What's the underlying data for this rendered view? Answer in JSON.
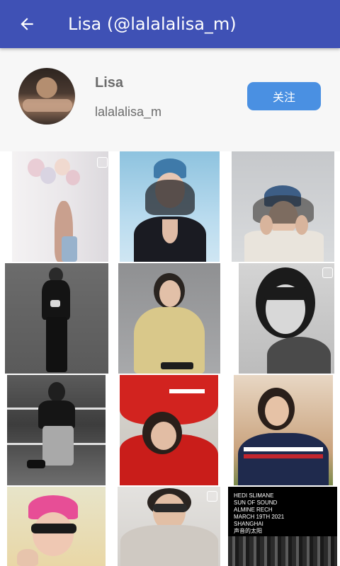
{
  "app_bar": {
    "back_icon": "arrow-back-icon",
    "title": "Lisa (@lalalalisa_m)",
    "color": "#3f51b5"
  },
  "profile": {
    "avatar": "avatar-photo",
    "name": "Lisa",
    "username": "lalalalisa_m",
    "follow_label": "关注",
    "follow_color": "#4a90e2"
  },
  "photos": [
    {
      "name": "photo-balloons",
      "selectable": true
    },
    {
      "name": "photo-blue-cap-portrait",
      "selectable": false
    },
    {
      "name": "photo-cap-hands-frame",
      "selectable": false
    },
    {
      "name": "photo-black-suit-full-body",
      "selectable": false
    },
    {
      "name": "photo-knit-sweater",
      "selectable": false
    },
    {
      "name": "photo-bw-closeup",
      "selectable": true
    },
    {
      "name": "photo-bw-tennis-court",
      "selectable": false
    },
    {
      "name": "photo-red-jacket",
      "selectable": false
    },
    {
      "name": "photo-striped-jacket",
      "selectable": false
    },
    {
      "name": "photo-pink-beanie",
      "selectable": false
    },
    {
      "name": "photo-sunglasses-fur",
      "selectable": true
    },
    {
      "name": "photo-sun-of-sound-poster",
      "selectable": false
    }
  ],
  "poster": {
    "lines": [
      "HEDI SLIMANE",
      "SUN OF SOUND",
      "ALMINE RECH",
      "MARCH 19TH 2021",
      "SHANGHAI",
      "声音的太阳"
    ]
  }
}
